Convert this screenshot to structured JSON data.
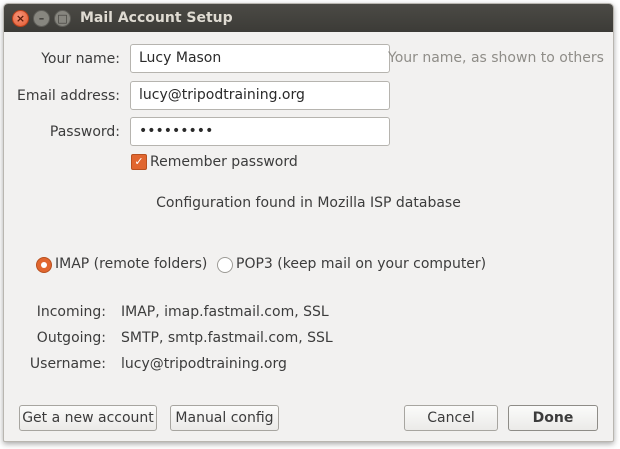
{
  "window": {
    "title": "Mail Account Setup",
    "close_glyph": "×",
    "min_glyph": "–",
    "max_glyph": "□"
  },
  "form": {
    "name_label": "Your name:",
    "name_value": "Lucy Mason",
    "name_hint": "Your name, as shown to others",
    "email_label": "Email address:",
    "email_value": "lucy@tripodtraining.org",
    "password_label": "Password:",
    "password_value": "•••••••••",
    "remember_label": "Remember password",
    "remember_checked": true
  },
  "status": "Configuration found in Mozilla ISP database",
  "protocol": {
    "imap_label": "IMAP (remote folders)",
    "pop3_label": "POP3 (keep mail on your computer)",
    "selected": "IMAP"
  },
  "servers": {
    "incoming_label": "Incoming:",
    "incoming_value": "IMAP, imap.fastmail.com, SSL",
    "outgoing_label": "Outgoing:",
    "outgoing_value": "SMTP, smtp.fastmail.com, SSL",
    "username_label": "Username:",
    "username_value": "lucy@tripodtraining.org"
  },
  "buttons": {
    "new_account": "Get a new account",
    "manual": "Manual config",
    "cancel": "Cancel",
    "done": "Done"
  },
  "colors": {
    "accent": "#e1662f",
    "titlebar": "#3c3b37",
    "background": "#f2f1f0"
  }
}
